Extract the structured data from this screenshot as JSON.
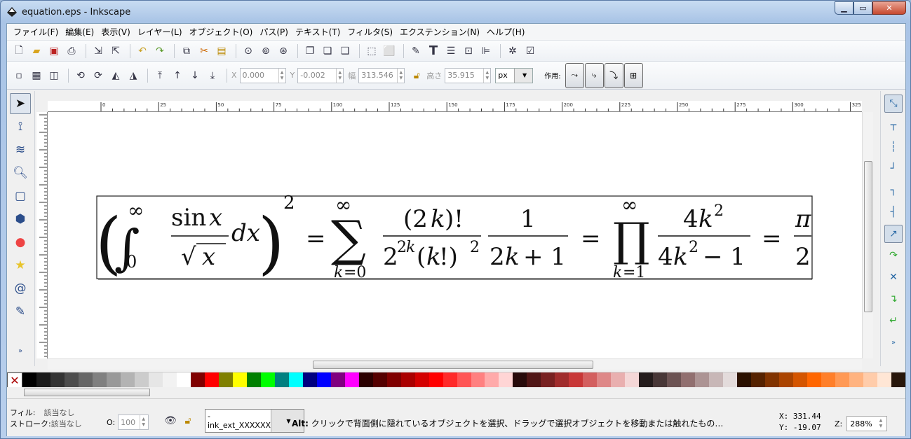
{
  "window": {
    "title": "equation.eps - Inkscape"
  },
  "menu": [
    "ファイル(F)",
    "編集(E)",
    "表示(V)",
    "レイヤー(L)",
    "オブジェクト(O)",
    "パス(P)",
    "テキスト(T)",
    "フィルタ(S)",
    "エクステンション(N)",
    "ヘルプ(H)"
  ],
  "toolbar2": {
    "x_label": "X",
    "x_value": "0.000",
    "y_label": "Y",
    "y_value": "-0.002",
    "w_label": "幅",
    "w_value": "313.546",
    "h_label": "高さ",
    "h_value": "35.915",
    "unit": "px",
    "affect_label": "作用:"
  },
  "ruler": {
    "h_ticks": [
      "0",
      "25",
      "50",
      "75",
      "100",
      "125",
      "150",
      "175",
      "200",
      "225",
      "250",
      "275",
      "300",
      "325"
    ],
    "v_ticks": [
      "5",
      "5",
      "0",
      "5",
      "0",
      "5",
      "0"
    ]
  },
  "palette": [
    "#000000",
    "#1a1a1a",
    "#333333",
    "#4d4d4d",
    "#666666",
    "#808080",
    "#999999",
    "#b3b3b3",
    "#cccccc",
    "#e6e6e6",
    "#f2f2f2",
    "#ffffff",
    "#800000",
    "#ff0000",
    "#808000",
    "#ffff00",
    "#008000",
    "#00ff00",
    "#008080",
    "#00ffff",
    "#000080",
    "#0000ff",
    "#800080",
    "#ff00ff",
    "#2b0000",
    "#550000",
    "#800000",
    "#aa0000",
    "#d40000",
    "#ff0000",
    "#ff2a2a",
    "#ff5555",
    "#ff8080",
    "#ffaaaa",
    "#ffd5d5",
    "#280b0b",
    "#501616",
    "#782121",
    "#a02c2c",
    "#c83737",
    "#d35f5f",
    "#de8787",
    "#e9afaf",
    "#f4d7d7",
    "#241c1c",
    "#483737",
    "#6c5353",
    "#916f6f",
    "#ac9393",
    "#c8b7b7",
    "#e3dbdb",
    "#2b1100",
    "#552200",
    "#803300",
    "#aa4400",
    "#d45500",
    "#ff6600",
    "#ff7f2a",
    "#ff9955",
    "#ffb380",
    "#ffccaa",
    "#ffe6d5",
    "#28170b"
  ],
  "status": {
    "fill_label": "フィル:",
    "fill_value": "該当なし",
    "stroke_label": "ストローク:",
    "stroke_value": "該当なし",
    "opacity_label": "O:",
    "opacity_value": "100",
    "layer": "-ink_ext_XXXXXX",
    "message_key": "Alt:",
    "message": " クリックで背面側に隠れているオブジェクトを選択、ドラッグで選択オブジェクトを移動または触れたもの…",
    "x_label": "X:",
    "x_value": "331.44",
    "y_label": "Y:",
    "y_value": "-19.07",
    "zoom_label": "Z:",
    "zoom_value": "288%"
  },
  "colors": {
    "accent": "#2b6aa6",
    "close": "#c74a2f"
  },
  "icons": {
    "select_tool": "arrow-icon",
    "node_tool": "node-icon",
    "tweak_tool": "tweak-icon",
    "zoom_tool": "zoom-icon",
    "rect_tool": "rect-icon",
    "box3d_tool": "box3d-icon",
    "ellipse_tool": "circle-icon",
    "star_tool": "star-icon",
    "spiral_tool": "spiral-icon",
    "pencil_tool": "pencil-icon"
  }
}
